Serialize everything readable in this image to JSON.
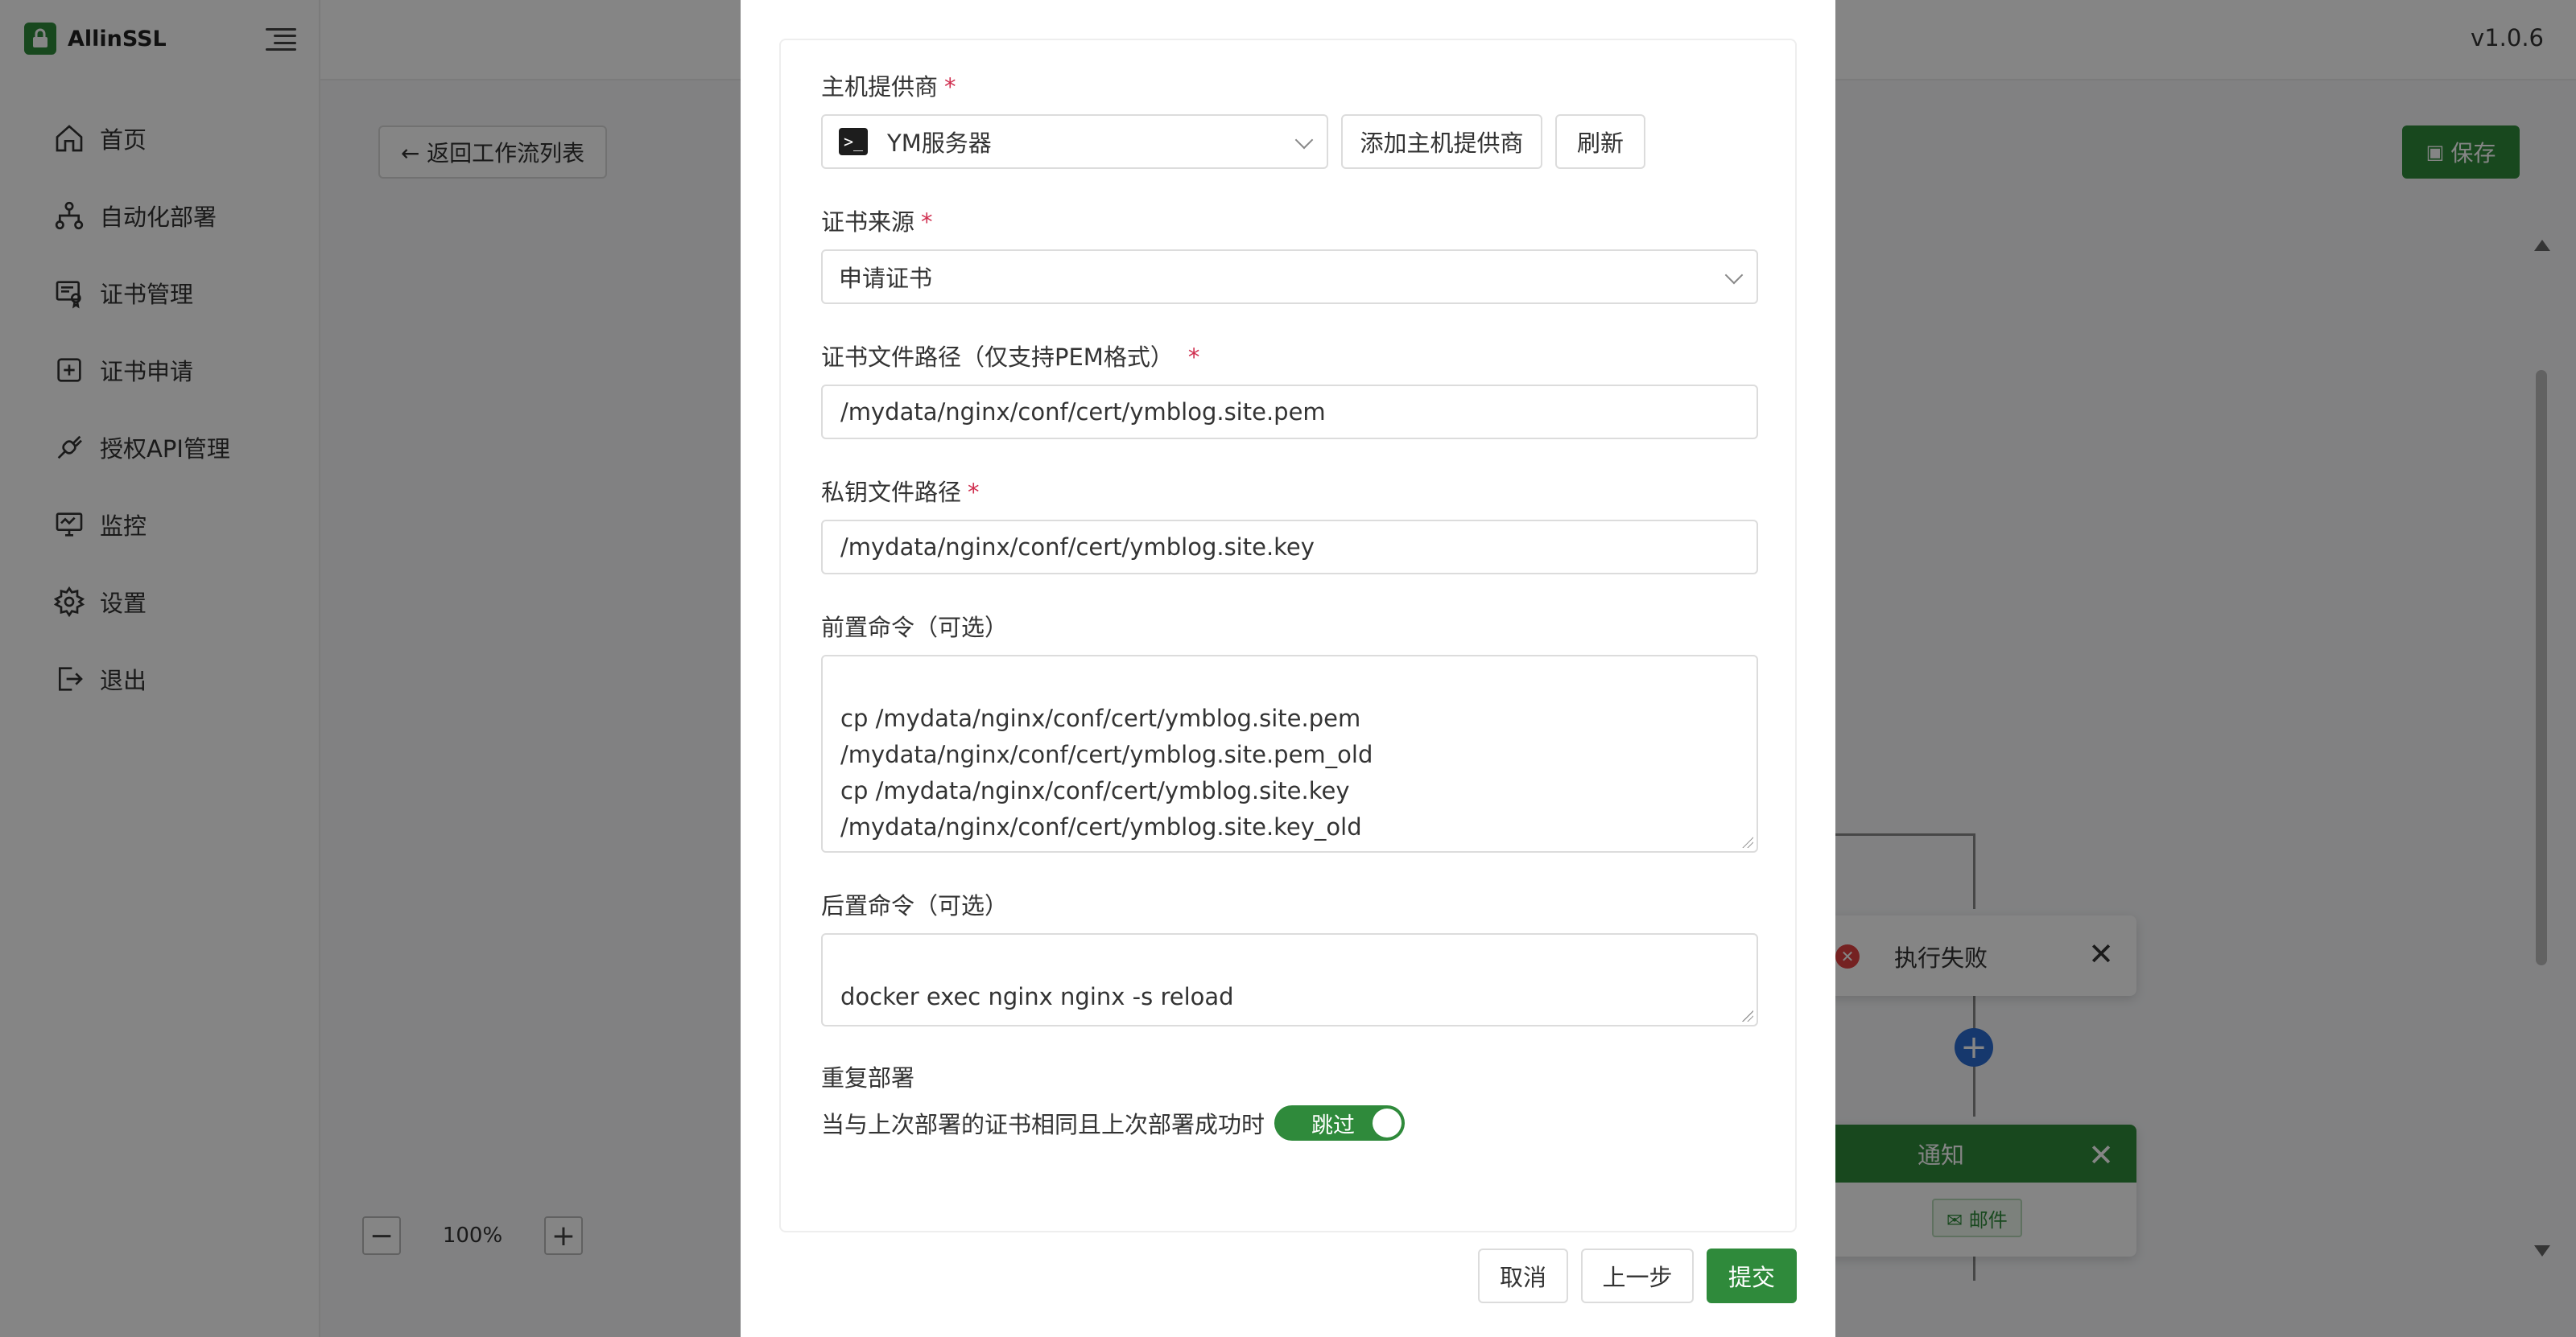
{
  "app": {
    "name": "AllinSSL",
    "version": "v1.0.6"
  },
  "sidebar": {
    "items": [
      {
        "label": "首页",
        "icon": "home-icon"
      },
      {
        "label": "自动化部署",
        "icon": "workflow-icon"
      },
      {
        "label": "证书管理",
        "icon": "certificate-icon"
      },
      {
        "label": "证书申请",
        "icon": "add-square-icon"
      },
      {
        "label": "授权API管理",
        "icon": "api-icon"
      },
      {
        "label": "监控",
        "icon": "monitor-icon"
      },
      {
        "label": "设置",
        "icon": "gear-icon"
      },
      {
        "label": "退出",
        "icon": "logout-icon"
      }
    ]
  },
  "toolbar": {
    "back_label": "← 返回工作流列表",
    "save_label": "保存"
  },
  "zoom": {
    "value": "100%",
    "minus": "−",
    "plus": "+"
  },
  "workflow": {
    "fail_node_label": "执行失败",
    "notify_node_label": "通知",
    "notify_tag": "✉ 邮件"
  },
  "form": {
    "host_provider": {
      "label": "主机提供商",
      "selected": "YM服务器",
      "add_button": "添加主机提供商",
      "refresh_button": "刷新"
    },
    "cert_source": {
      "label": "证书来源",
      "selected": "申请证书"
    },
    "cert_path": {
      "label": "证书文件路径（仅支持PEM格式）",
      "value": "/mydata/nginx/conf/cert/ymblog.site.pem"
    },
    "key_path": {
      "label": "私钥文件路径",
      "value": "/mydata/nginx/conf/cert/ymblog.site.key"
    },
    "pre_command": {
      "label": "前置命令（可选）",
      "value": "cp /mydata/nginx/conf/cert/ymblog.site.pem\n/mydata/nginx/conf/cert/ymblog.site.pem_old\ncp /mydata/nginx/conf/cert/ymblog.site.key\n/mydata/nginx/conf/cert/ymblog.site.key_old"
    },
    "post_command": {
      "label": "后置命令（可选）",
      "value": "docker exec nginx nginx -s reload"
    },
    "redeploy": {
      "label": "重复部署",
      "condition": "当与上次部署的证书相同且上次部署成功时",
      "toggle_label": "跳过"
    },
    "required_mark": "*"
  },
  "footer": {
    "cancel": "取消",
    "prev": "上一步",
    "submit": "提交"
  },
  "colors": {
    "primary": "#2f8a3b",
    "required": "#d03050",
    "add_node": "#2b6cd1",
    "error": "#e04242"
  }
}
